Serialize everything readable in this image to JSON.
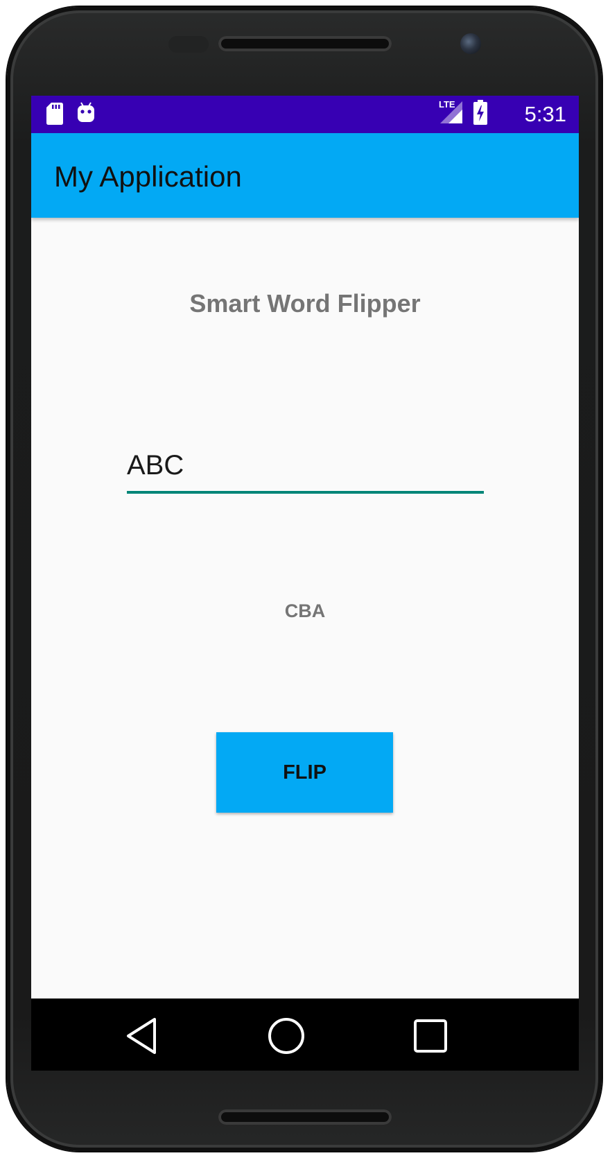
{
  "status_bar": {
    "time": "5:31",
    "network_label": "LTE",
    "left_icons": [
      "sd-card-icon",
      "android-debug-icon"
    ],
    "right_icons": [
      "lte-signal-icon",
      "battery-charging-icon"
    ],
    "color": "#3700b3"
  },
  "app_bar": {
    "title": "My Application",
    "color": "#03a9f4"
  },
  "content": {
    "heading": "Smart Word Flipper",
    "input_value": "ABC",
    "result": "CBA",
    "flip_label": "FLIP",
    "accent_color": "#008577"
  },
  "nav_bar": {
    "buttons": [
      "back-icon",
      "home-icon",
      "recents-icon"
    ]
  }
}
